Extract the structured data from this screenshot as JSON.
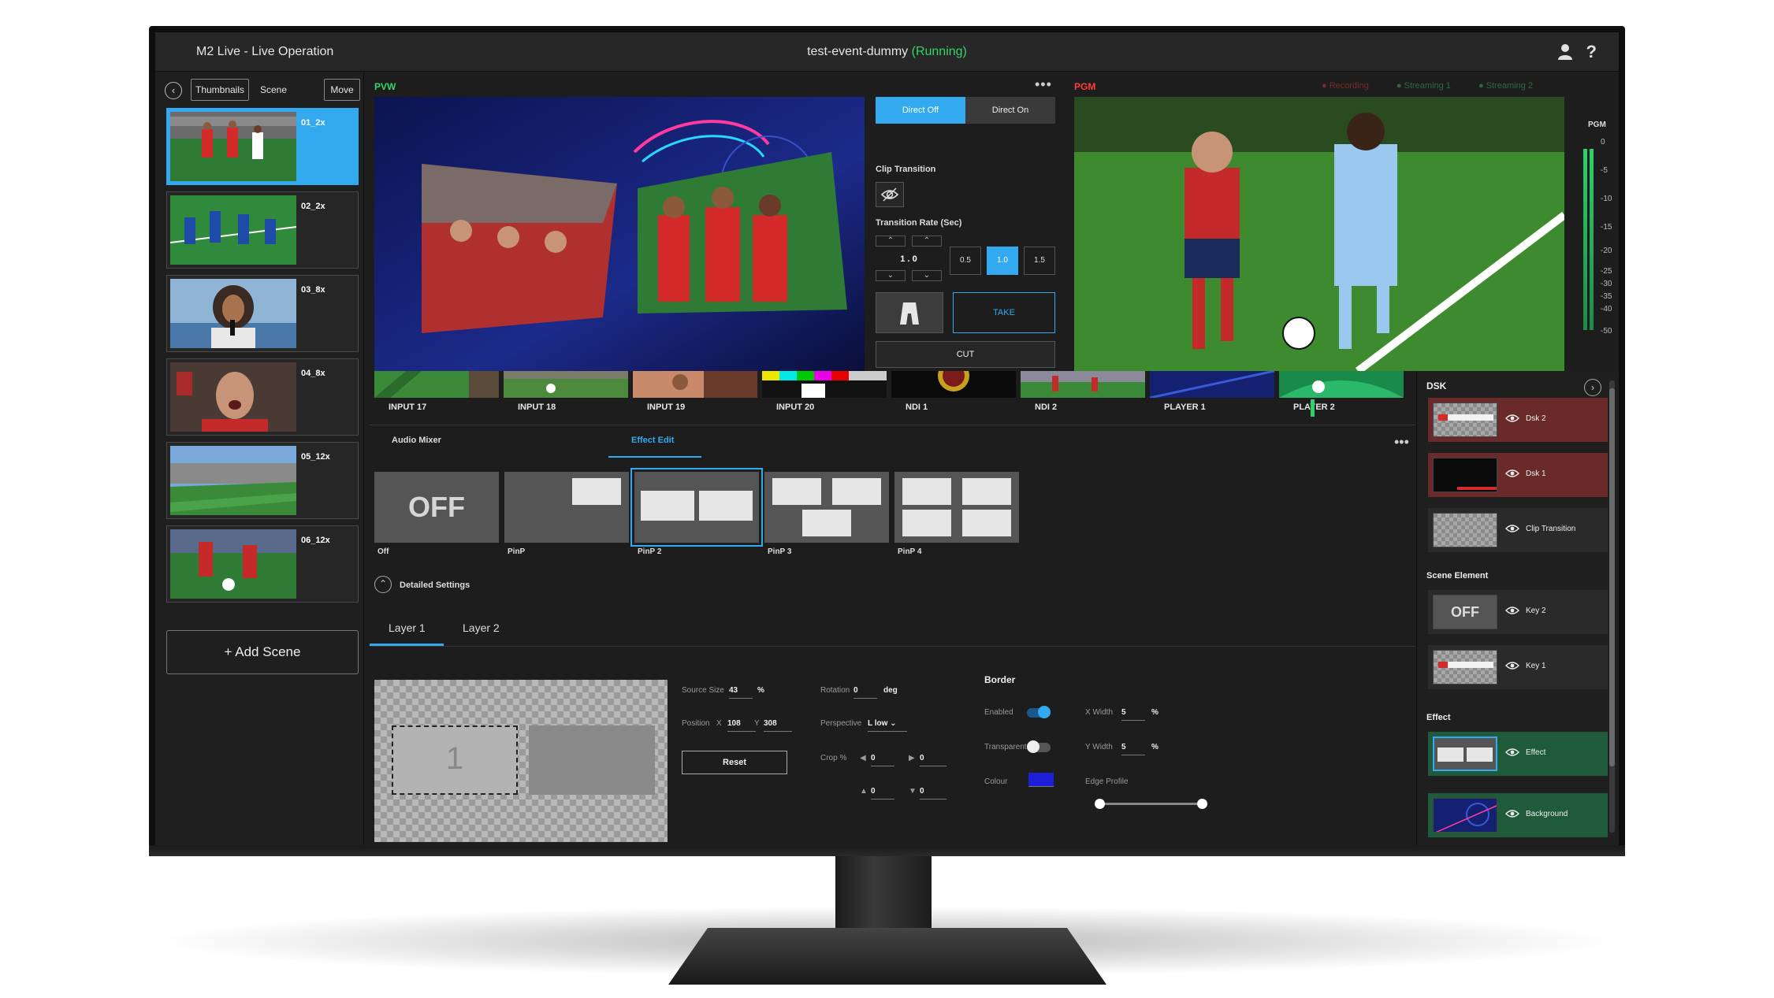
{
  "titlebar": {
    "app_title": "M2 Live - Live Operation",
    "event_name": "test-event-dummy",
    "event_status": "(Running)"
  },
  "scene_panel": {
    "tabs": [
      "Thumbnails",
      "Scene"
    ],
    "move_label": "Move",
    "scenes": [
      {
        "label": "01_2x",
        "active": true
      },
      {
        "label": "02_2x",
        "active": false
      },
      {
        "label": "03_8x",
        "active": false
      },
      {
        "label": "04_8x",
        "active": false
      },
      {
        "label": "05_12x",
        "active": false
      },
      {
        "label": "06_12x",
        "active": false
      }
    ],
    "add_scene_label": "Add Scene"
  },
  "monitors": {
    "pvw_label": "PVW",
    "pgm_label": "PGM",
    "status_badges": [
      "Recording",
      "Streaming 1",
      "Streaming 2"
    ]
  },
  "transition": {
    "direct_off": "Direct Off",
    "direct_on": "Direct On",
    "clip_transition_label": "Clip Transition",
    "transition_rate_label": "Transition Rate (Sec)",
    "rate_value": "1 . 0",
    "presets": [
      "0.5",
      "1.0",
      "1.5"
    ],
    "active_preset": "1.0",
    "take_label": "TAKE",
    "cut_label": "CUT"
  },
  "audio_meter": {
    "title": "PGM",
    "ticks": [
      "0",
      "-5",
      "-10",
      "-15",
      "-20",
      "-25",
      "-30",
      "-35",
      "-40",
      "-50"
    ]
  },
  "sources": [
    "INPUT 17",
    "INPUT 18",
    "INPUT 19",
    "INPUT 20",
    "NDI 1",
    "NDI 2",
    "PLAYER 1",
    "PLAYER 2"
  ],
  "edit_tabs": {
    "audio_mixer": "Audio Mixer",
    "effect_edit": "Effect Edit"
  },
  "effects": {
    "off_text": "OFF",
    "names": [
      "Off",
      "PinP",
      "PinP 2",
      "PinP 3",
      "PinP 4"
    ],
    "selected": "PinP 2"
  },
  "detailed_settings": {
    "label": "Detailed Settings",
    "layer_tabs": [
      "Layer 1",
      "Layer 2"
    ],
    "layer_box_number": "1",
    "source_size_label": "Source Size",
    "source_size_value": "43",
    "percent": "%",
    "position_label": "Position",
    "x_label": "X",
    "x_value": "108",
    "y_label": "Y",
    "y_value": "308",
    "rotation_label": "Rotation",
    "rotation_value": "0",
    "rotation_unit": "deg",
    "perspective_label": "Perspective",
    "perspective_value": "L low",
    "crop_label": "Crop %",
    "crop_values": [
      "0",
      "0",
      "0",
      "0"
    ],
    "reset_label": "Reset"
  },
  "border": {
    "heading": "Border",
    "enabled_label": "Enabled",
    "enabled": true,
    "transparent_label": "Transparent",
    "transparent": false,
    "colour_label": "Colour",
    "colour": "#1e1ed8",
    "x_width_label": "X Width",
    "x_width_value": "5",
    "y_width_label": "Y Width",
    "y_width_value": "5",
    "edge_profile_label": "Edge Profile"
  },
  "dsk_panel": {
    "title": "DSK",
    "dsk_items": [
      "Dsk 2",
      "Dsk 1",
      "Clip Transition"
    ],
    "scene_element_label": "Scene Element",
    "scene_elements": [
      "Key 2",
      "Key 1"
    ],
    "key2_thumb_text": "OFF",
    "effect_label": "Effect",
    "effect_items": [
      "Effect",
      "Background"
    ]
  },
  "colors": {
    "accent": "#33aaf0",
    "pvw": "#36d36b",
    "pgm": "#ff3b3b",
    "dsk_red": "#6a2a2a",
    "effect_green": "#1f5a3a"
  }
}
